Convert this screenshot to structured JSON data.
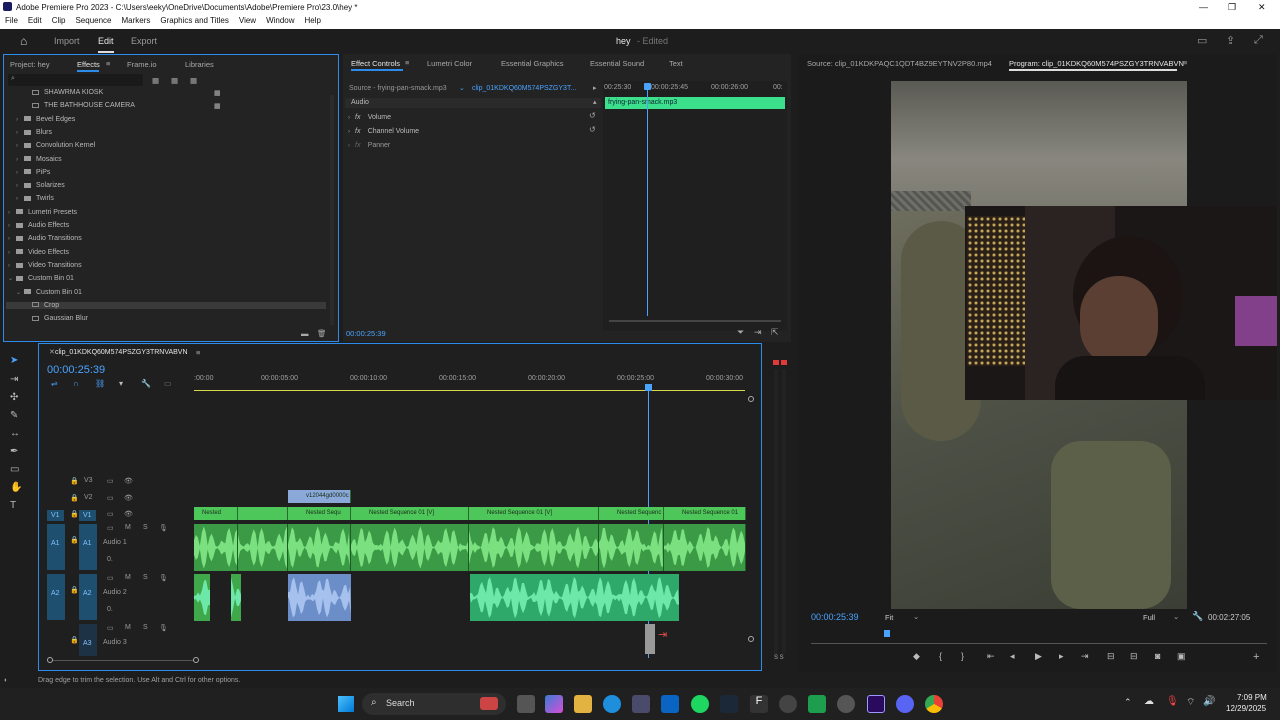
{
  "window": {
    "title": "Adobe Premiere Pro 2023 - C:\\Users\\eeky\\OneDrive\\Documents\\Adobe\\Premiere Pro\\23.0\\hey *"
  },
  "menu": [
    "File",
    "Edit",
    "Clip",
    "Sequence",
    "Markers",
    "Graphics and Titles",
    "View",
    "Window",
    "Help"
  ],
  "workspace": {
    "tabs": [
      "Import",
      "Edit",
      "Export"
    ],
    "active": "Edit",
    "project": "hey",
    "status": "- Edited"
  },
  "left_panel": {
    "tabs": [
      "Project: hey",
      "Effects",
      "Frame.io",
      "Libraries"
    ],
    "active_tab": "Effects",
    "search_placeholder": "",
    "items": [
      {
        "label": "SHAWRMA KIOSK",
        "indent": 2,
        "folder": false
      },
      {
        "label": "THE BATHHOUSE CAMERA",
        "indent": 2,
        "folder": false
      },
      {
        "label": "Bevel Edges",
        "indent": 1,
        "folder": true
      },
      {
        "label": "Blurs",
        "indent": 1,
        "folder": true
      },
      {
        "label": "Convolution Kernel",
        "indent": 1,
        "folder": true
      },
      {
        "label": "Mosaics",
        "indent": 1,
        "folder": true
      },
      {
        "label": "PiPs",
        "indent": 1,
        "folder": true
      },
      {
        "label": "Solarizes",
        "indent": 1,
        "folder": true
      },
      {
        "label": "Twirls",
        "indent": 1,
        "folder": true
      },
      {
        "label": "Lumetri Presets",
        "indent": 0,
        "folder": true
      },
      {
        "label": "Audio Effects",
        "indent": 0,
        "folder": true
      },
      {
        "label": "Audio Transitions",
        "indent": 0,
        "folder": true
      },
      {
        "label": "Video Effects",
        "indent": 0,
        "folder": true
      },
      {
        "label": "Video Transitions",
        "indent": 0,
        "folder": true
      },
      {
        "label": "Custom Bin 01",
        "indent": 0,
        "folder": true
      },
      {
        "label": "Custom Bin 01",
        "indent": 1,
        "folder": true
      },
      {
        "label": "Crop",
        "indent": 2,
        "folder": false
      },
      {
        "label": "Gaussian Blur",
        "indent": 2,
        "folder": false
      }
    ]
  },
  "effect_controls": {
    "tabs": [
      "Effect Controls",
      "Lumetri Color",
      "Essential Graphics",
      "Essential Sound",
      "Text"
    ],
    "active_tab": "Effect Controls",
    "source": "Source - frying-pan-smack.mp3",
    "clip": "clip_01KDKQ60M574PSZGY3T...",
    "section": "Audio",
    "effects": [
      "Volume",
      "Channel Volume",
      "Panner"
    ],
    "ruler": [
      "00:25:30",
      "00:00:25:45",
      "00:00:26:00",
      "00:"
    ],
    "clip_bar": "frying-pan-smack.mp3",
    "timecode": "00:00:25:39"
  },
  "program_monitor": {
    "source_tab": "Source: clip_01KDKPAQC1QDT4BZ9EYTNV2P80.mp4",
    "program_tab": "Program: clip_01KDKQ60M574PSZGY3TRNVABVN",
    "timecode": "00:00:25:39",
    "fit": "Fit",
    "quality": "Full",
    "duration": "00:02:27:05"
  },
  "timeline": {
    "sequence": "clip_01KDKQ60M574PSZGY3TRNVABVN",
    "timecode": "00:00:25:39",
    "ruler": [
      ":00:00",
      "00:00:05:00",
      "00:00:10:00",
      "00:00:15:00",
      "00:00:20:00",
      "00:00:25:00",
      "00:00:30:00"
    ],
    "tracks": {
      "video": [
        "V3",
        "V2",
        "V1"
      ],
      "audio": [
        {
          "id": "A1",
          "name": "Audio 1"
        },
        {
          "id": "A2",
          "name": "Audio 2"
        },
        {
          "id": "A3",
          "name": "Audio 3"
        }
      ]
    },
    "v2_clip": "v12044gd0000c",
    "v1_clips": [
      "Nested",
      "Nested Sequ",
      "Nested Sequence 01 [V]",
      "Nested Sequence 01 [V]",
      "Nested Sequenc",
      "Nested Sequence 01"
    ],
    "mute": "M",
    "solo": "S",
    "zero": "0."
  },
  "status": {
    "text": "Drag edge to trim the selection. Use Alt and Ctrl for other options."
  },
  "taskbar": {
    "search": "Search",
    "time": "7:09 PM",
    "date": "12/29/2025"
  },
  "colors": {
    "accent": "#2d8ceb",
    "clip_green": "#4ec75a",
    "audio_green": "#3fa84a",
    "audio_blue": "#6b8ec9",
    "timecode_blue": "#4aa3ff"
  }
}
